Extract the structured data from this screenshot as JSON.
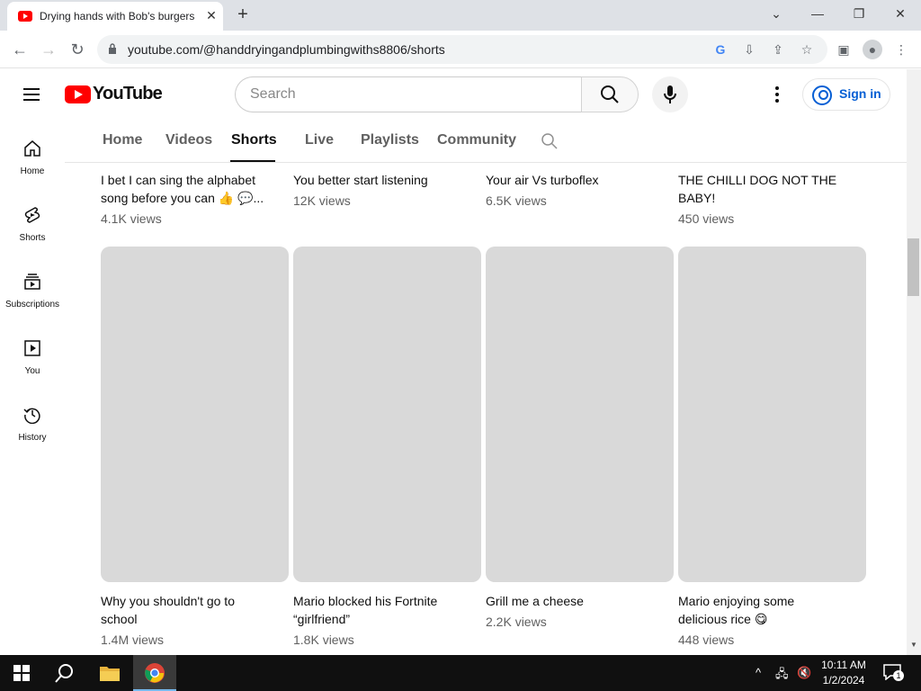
{
  "browser": {
    "tab_title": "Drying hands with Bob's burgers",
    "tab_close": "✕",
    "new_tab": "+",
    "url": "youtube.com/@handdryingandplumbingwiths8806/shorts",
    "window_controls": {
      "minimize": "—",
      "restore": "❐",
      "close": "✕",
      "dropdown": "⌄"
    }
  },
  "youtube": {
    "logo_text": "YouTube",
    "search_placeholder": "Search",
    "signin_label": "Sign in",
    "guide": [
      {
        "label": "Home",
        "icon": "home-icon"
      },
      {
        "label": "Shorts",
        "icon": "shorts-icon"
      },
      {
        "label": "Subscriptions",
        "icon": "subscriptions-icon"
      },
      {
        "label": "You",
        "icon": "you-icon"
      },
      {
        "label": "History",
        "icon": "history-icon"
      }
    ],
    "channel_tabs": [
      "Home",
      "Videos",
      "Shorts",
      "Live",
      "Playlists",
      "Community"
    ],
    "active_tab": "Shorts",
    "shorts_row1": [
      {
        "title_line1": "I bet I can sing the alphabet",
        "title_line2": "song before you can 👍 💬...",
        "views": "4.1K views"
      },
      {
        "title_line1": "You better start listening",
        "title_line2": "",
        "views": "12K views"
      },
      {
        "title_line1": "Your air Vs turboflex",
        "title_line2": "",
        "views": "6.5K views"
      },
      {
        "title_line1": "THE CHILLI DOG NOT THE",
        "title_line2": "BABY!",
        "views": "450 views"
      }
    ],
    "shorts_row2": [
      {
        "title_line1": "Why you shouldn't go to",
        "title_line2": "school",
        "views": "1.4M views"
      },
      {
        "title_line1": "Mario blocked his Fortnite",
        "title_line2": "“girlfriend”",
        "views": "1.8K views"
      },
      {
        "title_line1": "Grill me a cheese",
        "title_line2": "",
        "views": "2.2K views"
      },
      {
        "title_line1": "Mario enjoying some",
        "title_line2": "delicious rice 😋",
        "views": "448 views"
      }
    ]
  },
  "taskbar": {
    "time": "10:11 AM",
    "date": "1/2/2024",
    "notification_count": "1"
  }
}
